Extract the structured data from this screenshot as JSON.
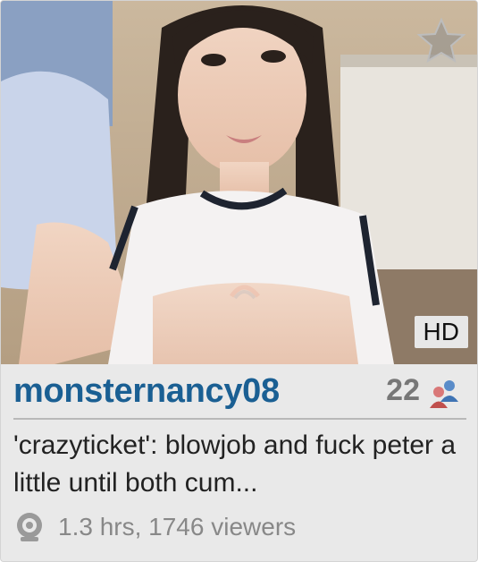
{
  "room": {
    "username": "monsternancy08",
    "age": "22",
    "subject": "'crazyticket': blowjob and fuck peter a little until both cum...",
    "stats": "1.3 hrs, 1746 viewers",
    "badge": "HD"
  },
  "icons": {
    "favorite": "star-icon",
    "gender": "couple-users-icon",
    "webcam": "webcam-icon"
  },
  "colors": {
    "username": "#1a5f93",
    "age": "#777777",
    "subject": "#222222",
    "stats": "#888888",
    "card_background": "#e9e9e9"
  }
}
